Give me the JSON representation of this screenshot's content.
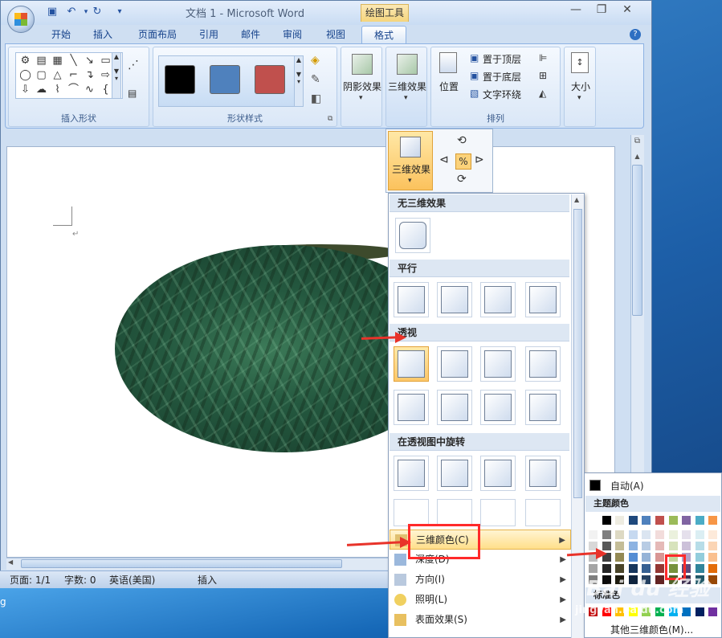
{
  "window": {
    "title": "文档 1 - Microsoft Word",
    "context_tab": "绘图工具"
  },
  "tabs": [
    "开始",
    "插入",
    "页面布局",
    "引用",
    "邮件",
    "审阅",
    "视图",
    "格式"
  ],
  "ribbon": {
    "insert_shapes": "插入形状",
    "shape_styles": "形状样式",
    "shadow": "阴影效果",
    "threed": "三维效果",
    "position": "位置",
    "bring_front": "置于顶层",
    "send_back": "置于底层",
    "wrap": "文字环绕",
    "arrange": "排列",
    "size": "大小"
  },
  "style_colors": [
    "#000000",
    "#4f81bd",
    "#c0504d"
  ],
  "popup": {
    "threed_btn": "三维效果"
  },
  "menu": {
    "none": "无三维效果",
    "parallel": "平行",
    "perspective": "透视",
    "rotate": "在透视图中旋转",
    "color": "三维颜色(C)",
    "depth": "深度(D)",
    "direction": "方向(I)",
    "lighting": "照明(L)",
    "surface": "表面效果(S)"
  },
  "palette": {
    "auto": "自动(A)",
    "theme": "主题颜色",
    "standard": "标准色",
    "more": "其他三维颜色(M)...",
    "theme_row": [
      "#ffffff",
      "#000000",
      "#eeece1",
      "#1f497d",
      "#4f81bd",
      "#c0504d",
      "#9bbb59",
      "#8064a2",
      "#4bacc6",
      "#f79646"
    ],
    "shade_rows": [
      [
        "#f2f2f2",
        "#7f7f7f",
        "#ddd9c3",
        "#c6d9f0",
        "#dbe5f1",
        "#f2dcdb",
        "#ebf1dd",
        "#e5e0ec",
        "#dbeef3",
        "#fdeada"
      ],
      [
        "#d8d8d8",
        "#595959",
        "#c4bd97",
        "#8db3e2",
        "#b8cce4",
        "#e5b9b7",
        "#d7e3bc",
        "#ccc1d9",
        "#b7dde8",
        "#fbd5b5"
      ],
      [
        "#bfbfbf",
        "#3f3f3f",
        "#938953",
        "#548dd4",
        "#95b3d7",
        "#d99694",
        "#c3d69b",
        "#b2a2c7",
        "#92cddc",
        "#fac08f"
      ],
      [
        "#a5a5a5",
        "#262626",
        "#494429",
        "#17365d",
        "#366092",
        "#953734",
        "#76923c",
        "#5f497a",
        "#31859b",
        "#e36c09"
      ],
      [
        "#7f7f7f",
        "#0c0c0c",
        "#1d1b10",
        "#0f243e",
        "#244061",
        "#632423",
        "#4f6128",
        "#3f3151",
        "#205867",
        "#974806"
      ]
    ],
    "standard_row": [
      "#c00000",
      "#ff0000",
      "#ffc000",
      "#ffff00",
      "#92d050",
      "#00b050",
      "#00b0f0",
      "#0070c0",
      "#002060",
      "#7030a0"
    ]
  },
  "status": {
    "page": "页面: 1/1",
    "words": "字数: 0",
    "lang": "英语(美国)",
    "mode": "插入"
  },
  "watermark": "Bai du 经验",
  "watermark_url": "jingyan.baidu.com"
}
